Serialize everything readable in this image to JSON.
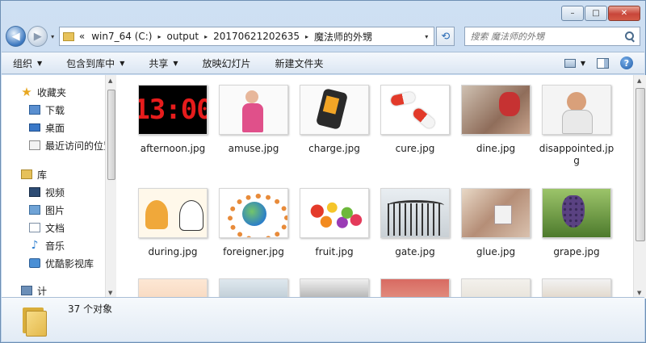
{
  "window": {
    "caption_buttons": {
      "minimize": "–",
      "maximize": "□",
      "close": "✕"
    }
  },
  "navigation": {
    "back_icon": "back-arrow-icon",
    "forward_icon": "forward-arrow-icon",
    "chevron": "«",
    "breadcrumbs": [
      "win7_64 (C:)",
      "output",
      "20170621202635",
      "魔法师的外甥"
    ],
    "separator": "▸",
    "dropdown": "▾",
    "refresh": "⟲",
    "search_placeholder": "搜索 魔法师的外甥"
  },
  "toolbar": {
    "organize": "组织",
    "include_in_library": "包含到库中",
    "share": "共享",
    "slideshow": "放映幻灯片",
    "new_folder": "新建文件夹",
    "dropdown_arrow": "▼",
    "help": "?"
  },
  "sidebar": {
    "favorites": {
      "label": "收藏夹",
      "items": [
        {
          "label": "下载",
          "icon": "download-folder-icon"
        },
        {
          "label": "桌面",
          "icon": "desktop-icon"
        },
        {
          "label": "最近访问的位置",
          "icon": "recent-places-icon"
        }
      ]
    },
    "libraries": {
      "label": "库",
      "items": [
        {
          "label": "视频",
          "icon": "videos-library-icon"
        },
        {
          "label": "图片",
          "icon": "pictures-library-icon"
        },
        {
          "label": "文档",
          "icon": "documents-library-icon"
        },
        {
          "label": "音乐",
          "icon": "music-library-icon"
        },
        {
          "label": "优酷影视库",
          "icon": "youku-library-icon"
        }
      ]
    },
    "partial_item": "计"
  },
  "files": [
    {
      "name": "afternoon.jpg",
      "thumb_text": "13:00"
    },
    {
      "name": "amuse.jpg"
    },
    {
      "name": "charge.jpg"
    },
    {
      "name": "cure.jpg"
    },
    {
      "name": "dine.jpg"
    },
    {
      "name": "disappointed.jpg"
    },
    {
      "name": "during.jpg"
    },
    {
      "name": "foreigner.jpg"
    },
    {
      "name": "fruit.jpg"
    },
    {
      "name": "gate.jpg"
    },
    {
      "name": "glue.jpg"
    },
    {
      "name": "grape.jpg"
    }
  ],
  "partial_thumbnails": 6,
  "status": {
    "item_count": "37 个对象"
  }
}
